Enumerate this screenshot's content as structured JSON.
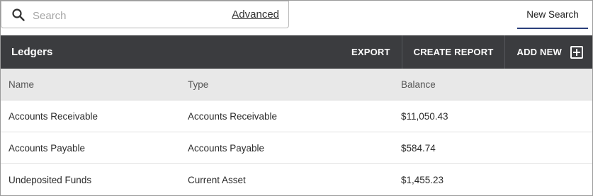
{
  "search": {
    "placeholder": "Search",
    "advanced_label": "Advanced"
  },
  "tabs": {
    "new_search": "New Search"
  },
  "panel": {
    "title": "Ledgers",
    "actions": {
      "export": "EXPORT",
      "create_report": "CREATE REPORT",
      "add_new": "ADD NEW"
    },
    "columns": [
      "Name",
      "Type",
      "Balance"
    ],
    "rows": [
      {
        "name": "Accounts Receivable",
        "type": "Accounts Receivable",
        "balance": "$11,050.43"
      },
      {
        "name": "Accounts Payable",
        "type": "Accounts Payable",
        "balance": "$584.74"
      },
      {
        "name": "Undeposited Funds",
        "type": "Current Asset",
        "balance": "$1,455.23"
      }
    ]
  },
  "colors": {
    "header_bg": "#3b3c3f",
    "column_header_bg": "#e8e8e8",
    "tab_underline": "#2a3f7a"
  },
  "icons": [
    "search-icon",
    "add-box-icon"
  ]
}
